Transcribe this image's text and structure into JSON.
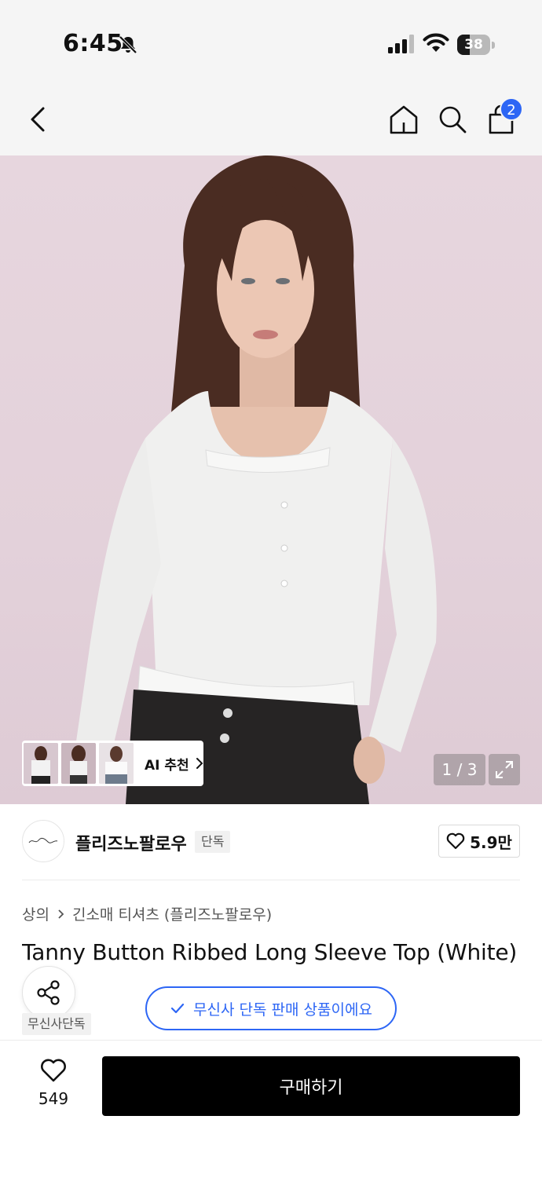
{
  "status_bar": {
    "time": "6:45",
    "battery": "38",
    "battery_level": 0.38
  },
  "nav": {
    "cart_count": "2"
  },
  "gallery": {
    "ai_label": "AI 추천",
    "page_indicator": "1 / 3"
  },
  "brand": {
    "name": "플리즈노팔로우",
    "badge": "단독",
    "likes": "5.9만"
  },
  "breadcrumb": {
    "category": "상의",
    "subcategory": "긴소매 티셔츠 (플리즈노팔로우)"
  },
  "product": {
    "title": "Tanny Button Ribbed Long Sleeve Top (White)",
    "tag": "무신사단독",
    "exclusive_notice": "무신사 단독 판매 상품이에요"
  },
  "bottom_bar": {
    "like_count": "549",
    "buy_label": "구매하기"
  },
  "colors": {
    "accent": "#2d66f5",
    "buy_button": "#000000",
    "image_background": "#e5d4dc"
  },
  "icons": [
    "bell-slash-icon",
    "signal-icon",
    "wifi-icon",
    "back-icon",
    "home-icon",
    "search-icon",
    "bag-icon",
    "chevron-right-icon",
    "expand-icon",
    "heart-icon",
    "share-icon",
    "check-icon"
  ]
}
